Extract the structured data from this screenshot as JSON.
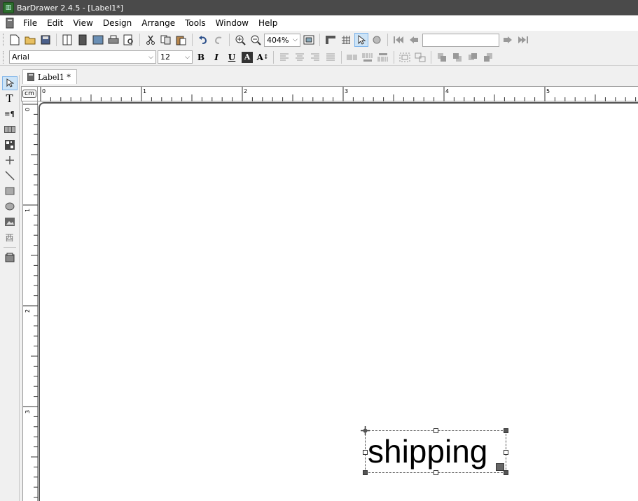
{
  "window": {
    "title": "BarDrawer 2.4.5 - [Label1*]"
  },
  "menu": [
    "File",
    "Edit",
    "View",
    "Design",
    "Arrange",
    "Tools",
    "Window",
    "Help"
  ],
  "toolbar": {
    "zoom_value": "404%",
    "font_name": "Arial",
    "font_size": "12",
    "bold": "B",
    "italic": "I",
    "underline": "U",
    "inverse": "A",
    "font_spacing": "A"
  },
  "tab": {
    "label": "Label1 *"
  },
  "ruler": {
    "unit": "cm",
    "h_marks": [
      "0",
      "1",
      "2",
      "3",
      "4",
      "5"
    ],
    "v_marks": [
      "0",
      "1",
      "2",
      "3"
    ]
  },
  "label_object": {
    "text": "shipping"
  },
  "colors": {
    "titlebar": "#4a4a4a",
    "selection_highlight": "#cde4f7"
  }
}
